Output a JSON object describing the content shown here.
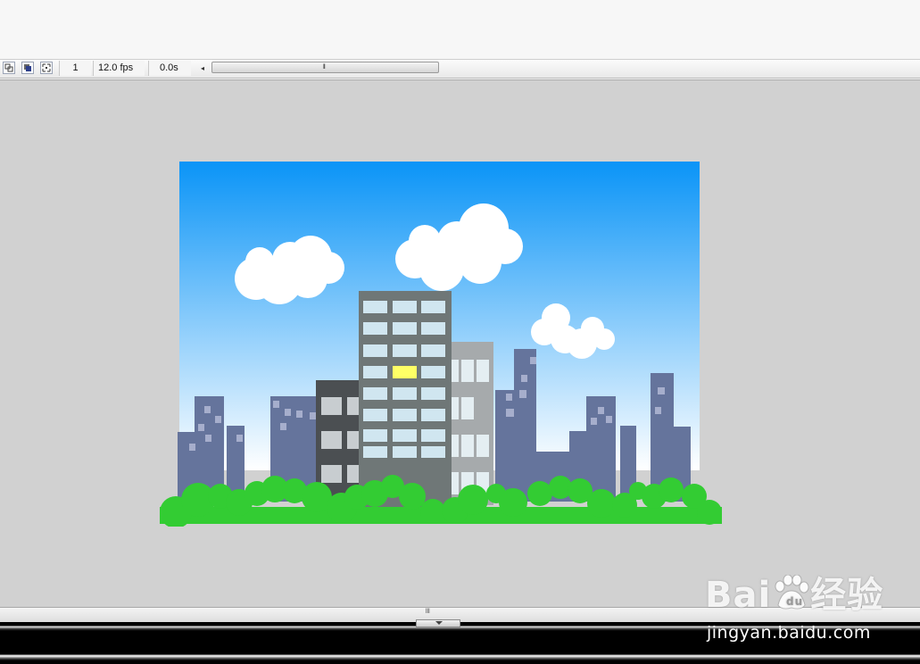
{
  "timeline": {
    "frame": "1",
    "fps": "12.0 fps",
    "elapsed": "0.0s",
    "buttons": [
      "center-frame-icon",
      "onion-skin-icon",
      "edit-multiple-frames-icon"
    ],
    "scroll_left_glyph": "◂",
    "thumb_grip": "lll"
  },
  "splitter": {
    "grip": "lll"
  },
  "scene": {
    "sky_colors": [
      "#0a94f7",
      "#ffffff"
    ],
    "grass_color": "#33cc33",
    "building_color": "#65749c",
    "lit_window_color": "#ffff66"
  },
  "watermark": {
    "brand_left": "Bai",
    "brand_right": "经验",
    "url": "jingyan.baidu.com"
  }
}
